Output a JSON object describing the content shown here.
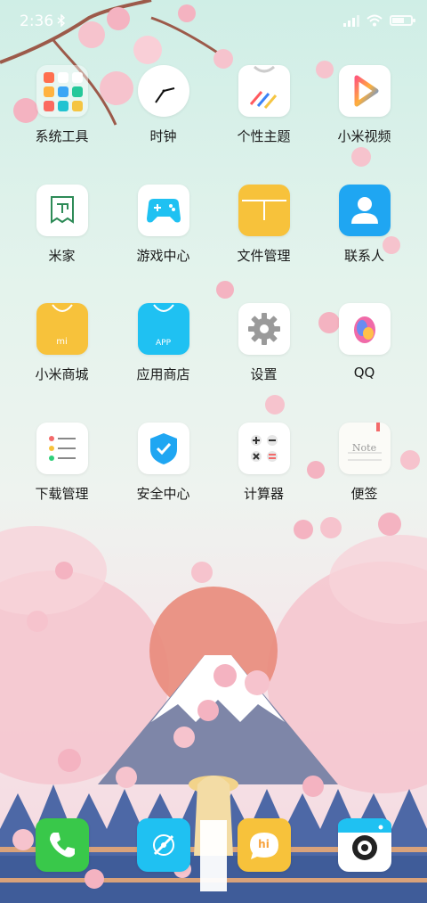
{
  "status_bar": {
    "time": "2:36"
  },
  "apps": [
    {
      "name": "系统工具",
      "icon": "folder-icon"
    },
    {
      "name": "时钟",
      "icon": "clock-icon"
    },
    {
      "name": "个性主题",
      "icon": "theme-icon"
    },
    {
      "name": "小米视频",
      "icon": "video-icon"
    },
    {
      "name": "米家",
      "icon": "mijia-icon"
    },
    {
      "name": "游戏中心",
      "icon": "gamepad-icon"
    },
    {
      "name": "文件管理",
      "icon": "file-manager-icon"
    },
    {
      "name": "联系人",
      "icon": "contacts-icon"
    },
    {
      "name": "小米商城",
      "icon": "mi-store-icon"
    },
    {
      "name": "应用商店",
      "icon": "app-store-icon"
    },
    {
      "name": "设置",
      "icon": "gear-icon"
    },
    {
      "name": "QQ",
      "icon": "qq-icon"
    },
    {
      "name": "下载管理",
      "icon": "download-manager-icon"
    },
    {
      "name": "安全中心",
      "icon": "security-shield-icon"
    },
    {
      "name": "计算器",
      "icon": "calculator-icon"
    },
    {
      "name": "便签",
      "icon": "notes-icon"
    }
  ],
  "notes_icon_text": "Note",
  "mi_store_icon_text": "mi",
  "app_store_icon_text": "APP",
  "messages_icon_text": "hi",
  "dock": [
    {
      "icon": "phone-icon"
    },
    {
      "icon": "browser-icon"
    },
    {
      "icon": "messages-icon"
    },
    {
      "icon": "camera-icon"
    }
  ],
  "colors": {
    "sky_top": "#cfeee6",
    "blossom": "#f4b9c6",
    "accent_blue": "#1fc1f2",
    "accent_yellow": "#f7c23b"
  }
}
